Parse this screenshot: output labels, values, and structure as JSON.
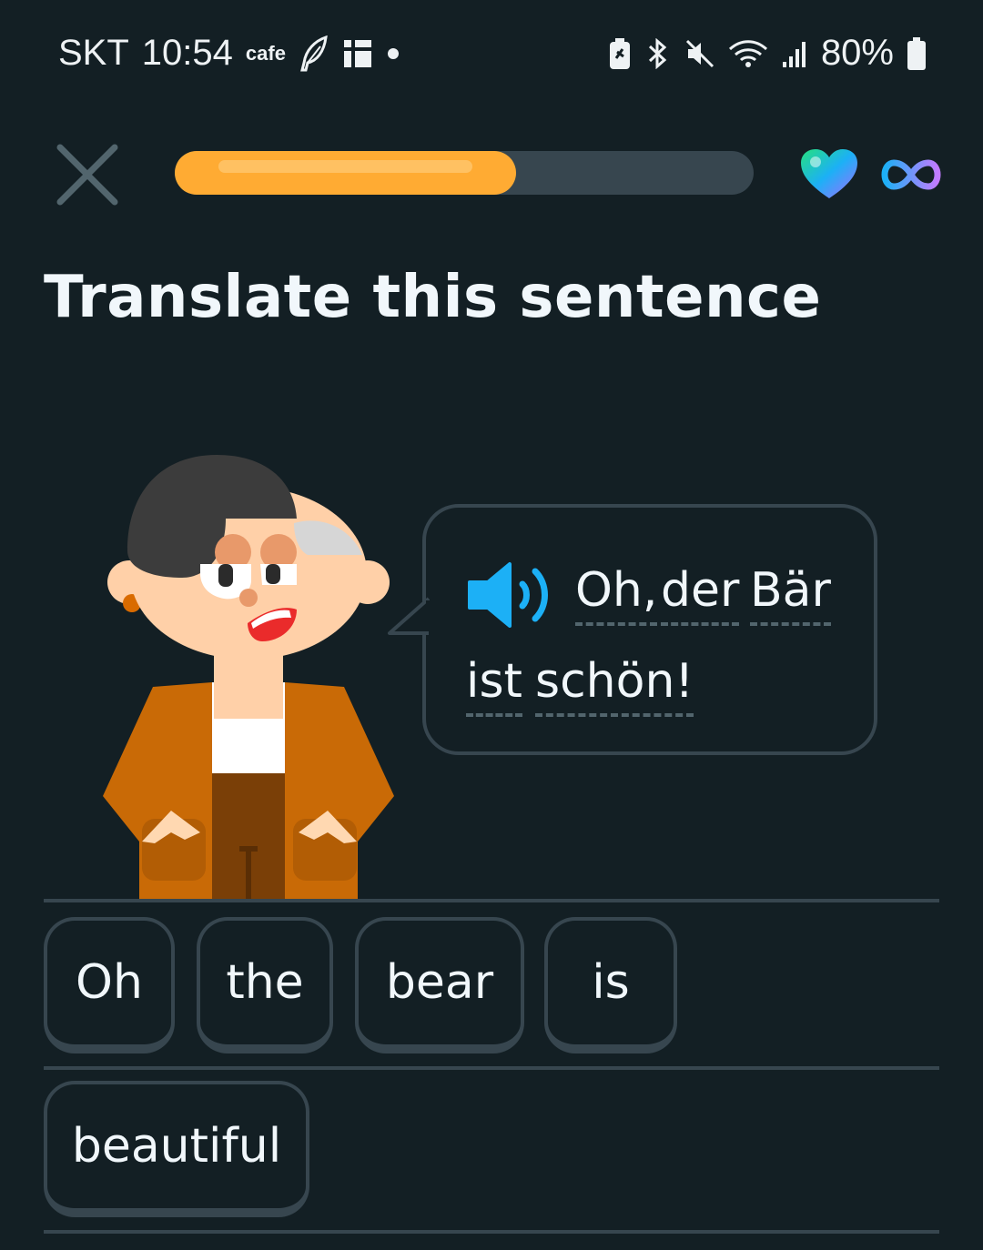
{
  "status_bar": {
    "carrier": "SKT",
    "time": "10:54",
    "cafe_label": "cafe",
    "battery": "80%"
  },
  "header": {
    "progress_percent": 59,
    "hearts": "infinite",
    "progress_color": "#ffab33",
    "icons": [
      "close-icon",
      "heart-icon",
      "infinity-icon"
    ]
  },
  "prompt": {
    "title": "Translate this sentence"
  },
  "speech_bubble": {
    "words": [
      "Oh,",
      "der",
      "Bär",
      "ist",
      "schön!"
    ],
    "speaker_icon": "speaker-icon",
    "speaker_color": "#1cb0f6"
  },
  "word_bank": {
    "row1": [
      "Oh",
      "the",
      "bear",
      "is"
    ],
    "row2": [
      "beautiful"
    ]
  },
  "colors": {
    "background": "#131f24",
    "border": "#37464f",
    "text": "#f1f7fb"
  }
}
